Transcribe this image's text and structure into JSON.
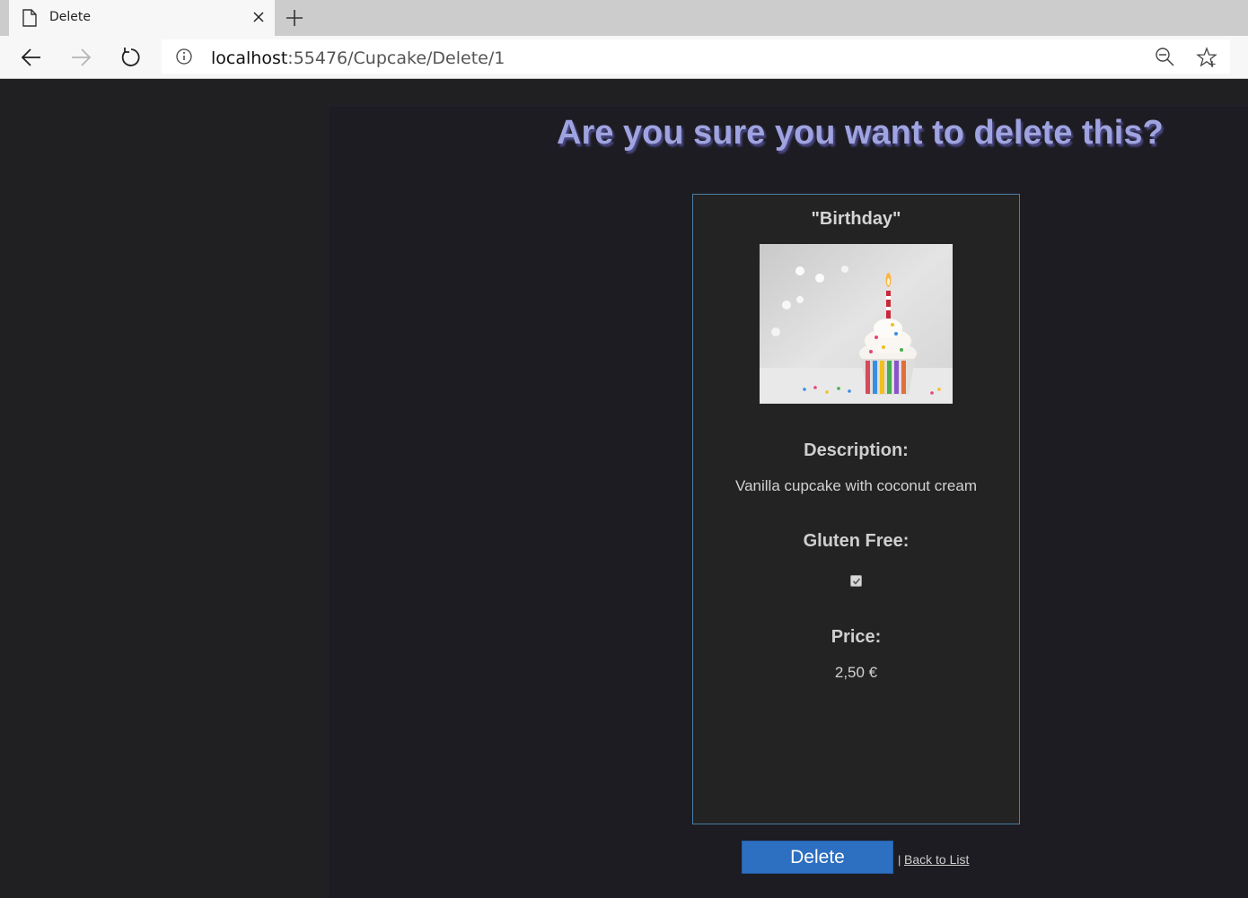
{
  "browser": {
    "tab_title": "Delete",
    "url_host": "localhost",
    "url_rest": ":55476/Cupcake/Delete/1"
  },
  "page": {
    "heading": "Are you sure you want to delete this?",
    "cupcake": {
      "name": "\"Birthday\"",
      "description_label": "Description:",
      "description": "Vanilla cupcake with coconut cream",
      "gluten_free_label": "Gluten Free:",
      "gluten_free": true,
      "price_label": "Price:",
      "price": "2,50 €"
    },
    "actions": {
      "delete_label": "Delete",
      "separator": "|",
      "back_label": "Back to List"
    }
  },
  "colors": {
    "heading": "#9fa3df",
    "delete_button": "#2d6fc1",
    "card_border": "#4d7da3"
  }
}
